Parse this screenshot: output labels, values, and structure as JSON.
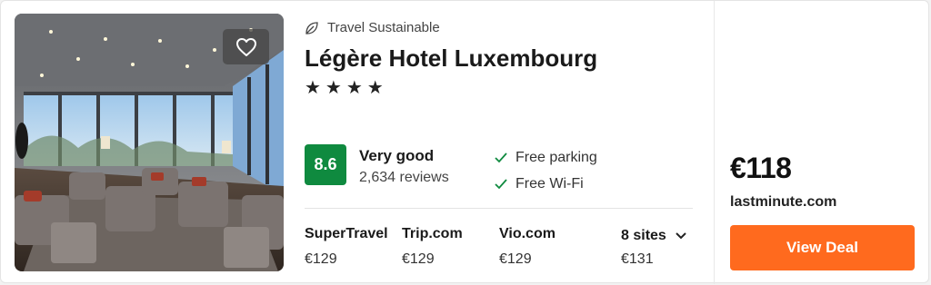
{
  "hotel": {
    "sustainability_label": "Travel Sustainable",
    "name": "Légère Hotel Luxembourg",
    "stars_display": "★★★★",
    "star_count": 4,
    "score": "8.6",
    "rating_text": "Very good",
    "reviews": "2,634 reviews",
    "amenities": [
      "Free parking",
      "Free Wi-Fi"
    ],
    "icons": {
      "favorite": "heart-icon",
      "sustainable": "leaf-icon",
      "amenity": "check-icon",
      "more": "chevron-down-icon"
    }
  },
  "sites": [
    {
      "name": "SuperTravel",
      "price": "€129"
    },
    {
      "name": "Trip.com",
      "price": "€129"
    },
    {
      "name": "Vio.com",
      "price": "€129"
    },
    {
      "name": "8 sites",
      "price": "€131"
    }
  ],
  "deal": {
    "price": "€118",
    "provider": "lastminute.com",
    "button_label": "View Deal"
  },
  "colors": {
    "score_bg": "#0f8a3f",
    "deal_button": "#ff6a1e",
    "check": "#0f8a3f"
  }
}
